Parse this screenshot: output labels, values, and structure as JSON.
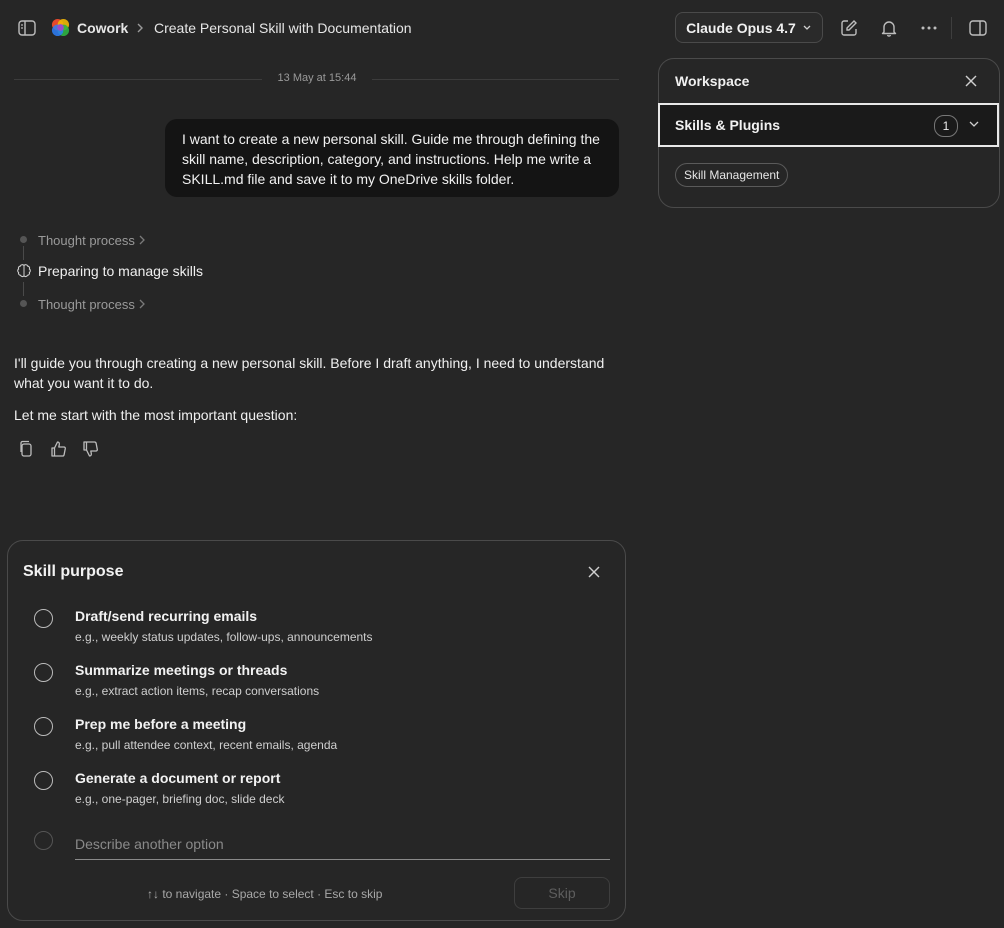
{
  "topbar": {
    "app_name": "Cowork",
    "breadcrumb_sep": ">",
    "chat_title": "Create Personal Skill with Documentation",
    "model_label": "Claude Opus 4.7"
  },
  "conversation": {
    "timestamp": "13 May at 15:44",
    "user_message": "I want to create a new personal skill. Guide me through defining the skill name, description, category, and instructions. Help me write a SKILL.md file and save it to my OneDrive skills folder.",
    "thought_1": "Thought process",
    "step_label": "Preparing to manage skills",
    "thought_2": "Thought process",
    "reply_p1": "I'll guide you through creating a new personal skill. Before I draft anything, I need to understand what you want it to do.",
    "reply_p2": "Let me start with the most important question:"
  },
  "workspace": {
    "title": "Workspace",
    "section_label": "Skills & Plugins",
    "section_count": "1",
    "chips": [
      "Skill Management"
    ]
  },
  "question": {
    "title": "Skill purpose",
    "options": [
      {
        "title": "Draft/send recurring emails",
        "desc": "e.g., weekly status updates, follow-ups, announcements"
      },
      {
        "title": "Summarize meetings or threads",
        "desc": "e.g., extract action items, recap conversations"
      },
      {
        "title": "Prep me before a meeting",
        "desc": "e.g., pull attendee context, recent emails, agenda"
      },
      {
        "title": "Generate a document or report",
        "desc": "e.g., one-pager, briefing doc, slide deck"
      }
    ],
    "other_placeholder": "Describe another option",
    "hint": "↑↓ to navigate · Space to select · Esc to skip",
    "skip_label": "Skip"
  },
  "icons": {
    "sidebar": "sidebar-toggle-icon",
    "logo": "cowork-logo-icon",
    "new_chat": "compose-icon",
    "notifications": "bell-icon",
    "more": "ellipsis-icon",
    "panel": "panel-toggle-icon"
  },
  "colors": {
    "background": "#262626",
    "bubble": "#141414",
    "logo_colors": [
      "#e6492d",
      "#f2b705",
      "#2fb344",
      "#2d7ff9",
      "#9b4dca"
    ]
  }
}
